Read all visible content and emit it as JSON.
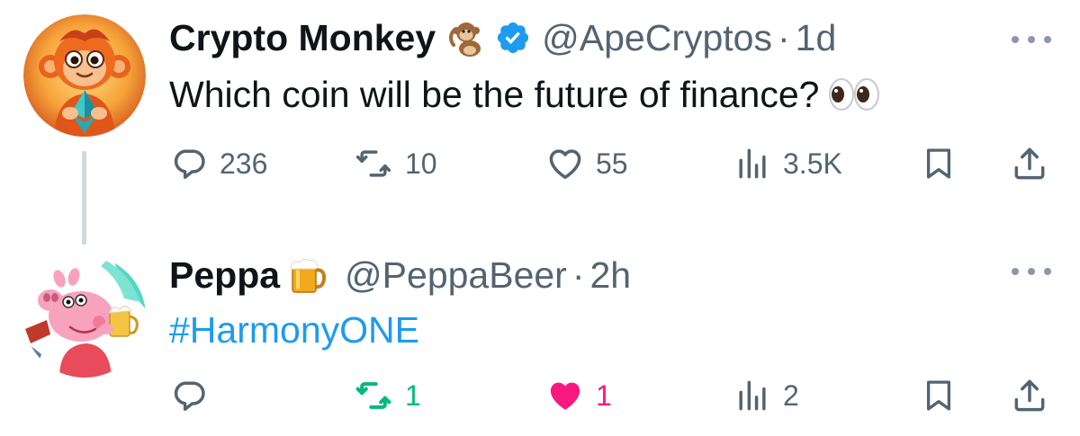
{
  "tweets": [
    {
      "name": "Crypto Monkey",
      "name_emoji": "monkey-emoji",
      "verified": true,
      "handle": "@ApeCryptos",
      "separator": "·",
      "time": "1d",
      "text": "Which coin will be the future of finance?",
      "text_emoji": "eyes-emoji",
      "stats": {
        "replies": "236",
        "retweets": "10",
        "likes": "55",
        "views": "3.5K"
      }
    },
    {
      "name": "Peppa",
      "name_emoji": "beer-mug-emoji",
      "verified": false,
      "handle": "@PeppaBeer",
      "separator": "·",
      "time": "2h",
      "text": "#HarmonyONE",
      "stats": {
        "replies": "",
        "retweets": "1",
        "likes": "1",
        "views": "2"
      },
      "retweeted": true,
      "liked": true
    }
  ],
  "colors": {
    "text": "#0f1419",
    "secondary": "#536471",
    "link": "#1d9bf0",
    "verified": "#1d9bf0",
    "retweet_active": "#00ba7c",
    "like_active": "#f91880",
    "thread_line": "#cfd9de"
  }
}
